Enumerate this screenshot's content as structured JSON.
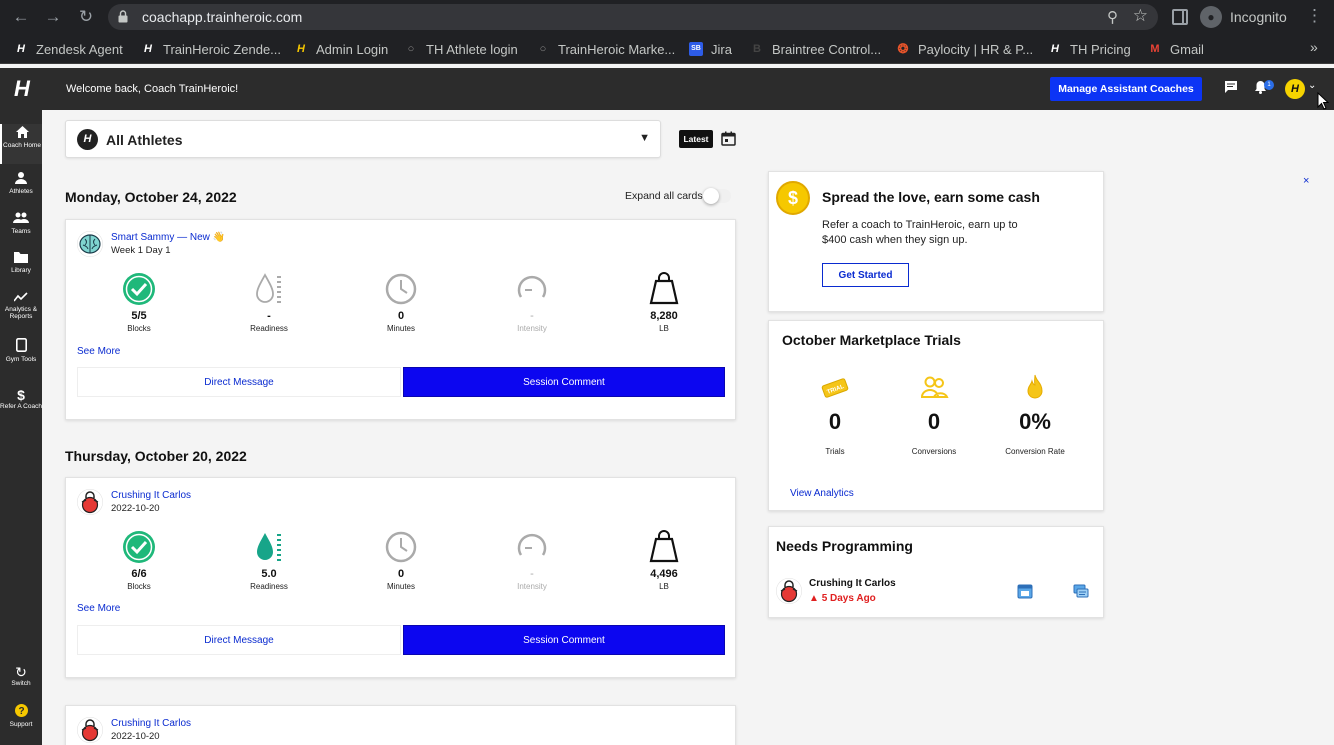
{
  "browser": {
    "url": "coachapp.trainheroic.com",
    "profile": "Incognito",
    "bookmarks": [
      {
        "label": "Zendesk Agent",
        "icon": "H"
      },
      {
        "label": "TrainHeroic Zende...",
        "icon": "H"
      },
      {
        "label": "Admin Login",
        "icon": "H"
      },
      {
        "label": "TH Athlete login",
        "icon": "globe"
      },
      {
        "label": "TrainHeroic Marke...",
        "icon": "globe"
      },
      {
        "label": "Jira",
        "icon": "SB"
      },
      {
        "label": "Braintree Control...",
        "icon": "B"
      },
      {
        "label": "Paylocity | HR & P...",
        "icon": "life-ring"
      },
      {
        "label": "TH Pricing",
        "icon": "H"
      },
      {
        "label": "Gmail",
        "icon": "M"
      }
    ],
    "more": "»"
  },
  "header": {
    "welcome": "Welcome back, Coach TrainHeroic!",
    "manage_button": "Manage Assistant Coaches",
    "notification_count": "1",
    "avatar_letter": "H"
  },
  "leftnav": {
    "items": [
      {
        "label": "Coach Home",
        "icon": "home-icon"
      },
      {
        "label": "Athletes",
        "icon": "person-icon"
      },
      {
        "label": "Teams",
        "icon": "group-icon"
      },
      {
        "label": "Library",
        "icon": "folder-icon"
      },
      {
        "label": "Analytics & Reports",
        "icon": "chart-icon"
      },
      {
        "label": "Gym Tools",
        "icon": "tablet-icon"
      },
      {
        "label": "Refer A Coach",
        "icon": "dollar-icon"
      },
      {
        "label": "Switch",
        "icon": "switch-icon"
      },
      {
        "label": "Support",
        "icon": "help-icon"
      }
    ]
  },
  "filter": {
    "athlete_select": "All Athletes",
    "latest_label": "Latest"
  },
  "feed": {
    "expand_all_label": "Expand all cards",
    "days": [
      {
        "heading": "Monday, October 24, 2022",
        "cards": [
          {
            "athlete": "Smart Sammy — New 👋",
            "subtitle": "Week 1 Day 1",
            "blocks": "5/5",
            "blocks_label": "Blocks",
            "readiness": "-",
            "readiness_label": "Readiness",
            "minutes": "0",
            "minutes_label": "Minutes",
            "intensity": "-",
            "intensity_label": "Intensity",
            "weight": "8,280",
            "weight_label": "LB",
            "see_more": "See More",
            "dm": "Direct Message",
            "comment": "Session Comment"
          }
        ]
      },
      {
        "heading": "Thursday, October 20, 2022",
        "cards": [
          {
            "athlete": "Crushing It Carlos",
            "subtitle": "2022-10-20",
            "blocks": "6/6",
            "blocks_label": "Blocks",
            "readiness": "5.0",
            "readiness_label": "Readiness",
            "minutes": "0",
            "minutes_label": "Minutes",
            "intensity": "-",
            "intensity_label": "Intensity",
            "weight": "4,496",
            "weight_label": "LB",
            "see_more": "See More",
            "dm": "Direct Message",
            "comment": "Session Comment"
          },
          {
            "athlete": "Crushing It Carlos",
            "subtitle": "2022-10-20"
          }
        ]
      }
    ]
  },
  "referral": {
    "title": "Spread the love, earn some cash",
    "description": "Refer a coach to TrainHeroic, earn up to $400 cash when they sign up.",
    "button": "Get Started",
    "close": "×"
  },
  "marketplace": {
    "title": "October Marketplace Trials",
    "stats": [
      {
        "value": "0",
        "label": "Trials",
        "icon": "ticket-icon"
      },
      {
        "value": "0",
        "label": "Conversions",
        "icon": "people-icon"
      },
      {
        "value": "0%",
        "label": "Conversion Rate",
        "icon": "flame-icon"
      }
    ],
    "link": "View Analytics"
  },
  "needs_programming": {
    "title": "Needs Programming",
    "athlete": "Crushing It Carlos",
    "due": "5 Days Ago"
  },
  "colors": {
    "accent_blue": "#0c34f5",
    "comment_blue": "#0c06f0",
    "link_blue": "#0a2bd0",
    "success_green": "#1fb87a",
    "readiness_teal": "#17a589",
    "warning_red": "#e02020",
    "nav_dark": "#2c2c2c"
  }
}
